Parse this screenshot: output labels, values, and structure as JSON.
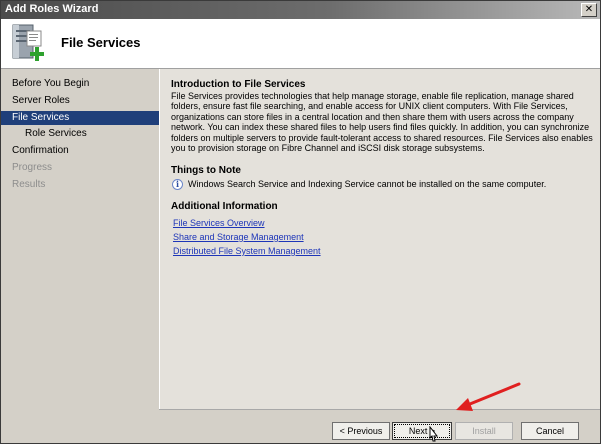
{
  "window": {
    "title": "Add Roles Wizard",
    "close_glyph": "✕"
  },
  "header": {
    "title": "File Services",
    "icon": "file-services-add-icon"
  },
  "nav": {
    "items": [
      {
        "label": "Before You Begin",
        "state": "normal"
      },
      {
        "label": "Server Roles",
        "state": "normal"
      },
      {
        "label": "File Services",
        "state": "active"
      },
      {
        "label": "Role Services",
        "state": "normal"
      },
      {
        "label": "Confirmation",
        "state": "normal"
      },
      {
        "label": "Progress",
        "state": "disabled"
      },
      {
        "label": "Results",
        "state": "disabled"
      }
    ]
  },
  "content": {
    "intro_heading": "Introduction to File Services",
    "intro_text": "File Services provides technologies that help manage storage, enable file replication, manage shared folders, ensure fast file searching, and enable access for UNIX client computers. With File Services, organizations can store files in a central location and then share them with users across the company network. You can index these shared files to help users find files quickly. In addition, you can synchronize folders on multiple servers to provide fault-tolerant access to shared resources. File Services also enables you to provision storage on Fibre Channel and iSCSI disk storage subsystems.",
    "notes_heading": "Things to Note",
    "note_text": "Windows Search Service and Indexing Service cannot be installed on the same computer.",
    "additional_heading": "Additional Information",
    "links": [
      "File Services Overview",
      "Share and Storage Management",
      "Distributed File System Management"
    ]
  },
  "footer": {
    "previous_label": "< Previous",
    "next_label": "Next >",
    "install_label": "Install",
    "cancel_label": "Cancel"
  },
  "colors": {
    "nav_active": "#1f3f7a",
    "link": "#1d35b8",
    "annotation_arrow": "#e02020"
  }
}
